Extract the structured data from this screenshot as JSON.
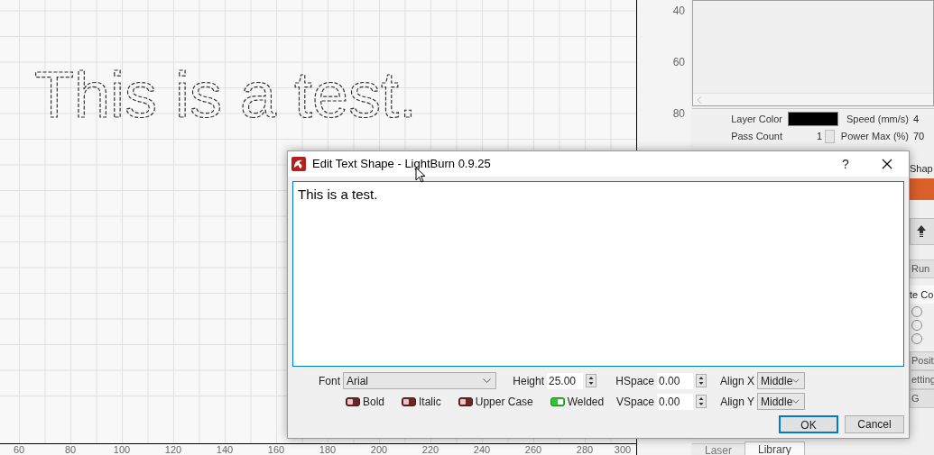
{
  "canvas": {
    "text": "This is a test.",
    "x_ruler": [
      "60",
      "80",
      "100",
      "120",
      "140",
      "160",
      "180",
      "200",
      "220",
      "240",
      "260",
      "280",
      "300"
    ],
    "y_ruler": [
      "40",
      "60",
      "80"
    ]
  },
  "layer_settings": [
    {
      "kind": "color",
      "label": "Layer Color",
      "color": "#000000",
      "right_label": "Speed (mm/s)",
      "right_value": "4"
    },
    {
      "kind": "spin",
      "label": "Pass Count",
      "value": "1",
      "right_label": "Power Max (%)",
      "right_value": "70"
    }
  ],
  "side_panel": {
    "items": [
      {
        "kind": "label",
        "text": "Shap"
      },
      {
        "kind": "accent_bar"
      },
      {
        "kind": "icon_button"
      },
      {
        "kind": "button",
        "text": "Run"
      },
      {
        "kind": "header",
        "text": "te Co"
      },
      {
        "kind": "radio",
        "selected": false
      },
      {
        "kind": "radio",
        "selected": false
      },
      {
        "kind": "radio",
        "selected": false
      },
      {
        "kind": "button",
        "text": "Positi"
      },
      {
        "kind": "button",
        "text": "etting"
      },
      {
        "kind": "button",
        "text": "G"
      }
    ],
    "tabs": [
      {
        "label": "Laser",
        "selected": false
      },
      {
        "label": "Library",
        "selected": true
      }
    ]
  },
  "dialog": {
    "title": "Edit Text Shape - LightBurn 0.9.25",
    "help": "?",
    "text": "This is a test.",
    "font": {
      "label": "Font",
      "value": "Arial"
    },
    "height": {
      "label": "Height",
      "value": "25.00"
    },
    "hspace": {
      "label": "HSpace",
      "value": "0.00"
    },
    "vspace": {
      "label": "VSpace",
      "value": "0.00"
    },
    "align_x": {
      "label": "Align X",
      "value": "Middle"
    },
    "align_y": {
      "label": "Align Y",
      "value": "Middle"
    },
    "toggles": [
      {
        "label": "Bold",
        "on": false
      },
      {
        "label": "Italic",
        "on": false
      },
      {
        "label": "Upper Case",
        "on": false
      },
      {
        "label": "Welded",
        "on": true
      }
    ],
    "buttons": [
      {
        "label": "OK",
        "default": true
      },
      {
        "label": "Cancel",
        "default": false
      }
    ]
  }
}
